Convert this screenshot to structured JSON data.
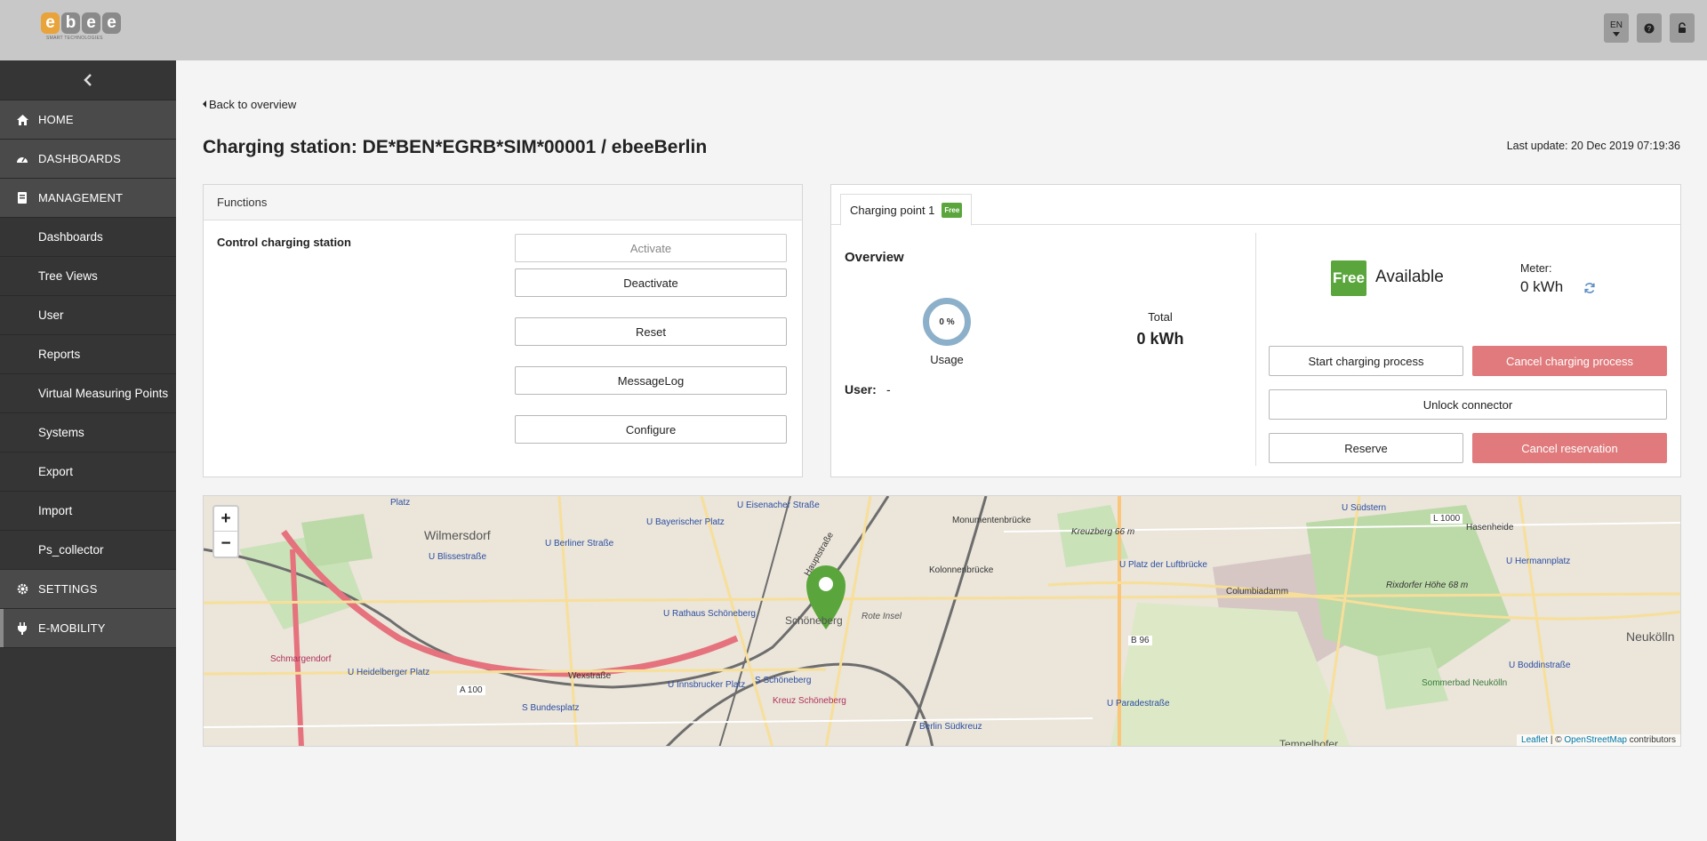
{
  "header": {
    "logo_text": [
      "e",
      "b",
      "e",
      "e"
    ],
    "logo_sub": "SMART TECHNOLOGIES",
    "lang_label": "EN",
    "help_icon": "question-icon",
    "lock_icon": "lock-icon"
  },
  "sidebar": {
    "collapse_icon": "chevron-left-icon",
    "items": [
      {
        "label": "HOME",
        "icon": "home-icon",
        "level": "top"
      },
      {
        "label": "DASHBOARDS",
        "icon": "dashboard-icon",
        "level": "top"
      },
      {
        "label": "MANAGEMENT",
        "icon": "book-icon",
        "level": "top"
      },
      {
        "label": "Dashboards",
        "level": "sub"
      },
      {
        "label": "Tree Views",
        "level": "sub"
      },
      {
        "label": "User",
        "level": "sub"
      },
      {
        "label": "Reports",
        "level": "sub"
      },
      {
        "label": "Virtual Measuring Points",
        "level": "sub"
      },
      {
        "label": "Systems",
        "level": "sub"
      },
      {
        "label": "Export",
        "level": "sub"
      },
      {
        "label": "Import",
        "level": "sub"
      },
      {
        "label": "Ps_collector",
        "level": "sub"
      },
      {
        "label": "SETTINGS",
        "icon": "gear-icon",
        "level": "top"
      },
      {
        "label": "E-MOBILITY",
        "icon": "plug-icon",
        "level": "top"
      }
    ]
  },
  "main": {
    "back_label": "Back to overview",
    "title": "Charging station: DE*BEN*EGRB*SIM*00001 / ebeeBerlin",
    "last_update": "Last update: 20 Dec 2019 07:19:36"
  },
  "functions": {
    "heading": "Functions",
    "control_label": "Control charging station",
    "buttons": {
      "activate": "Activate",
      "deactivate": "Deactivate",
      "reset": "Reset",
      "messagelog": "MessageLog",
      "configure": "Configure"
    }
  },
  "charging_point": {
    "tab_label": "Charging point 1",
    "tab_badge": "Free",
    "overview_title": "Overview",
    "usage_percent": "0 %",
    "usage_label": "Usage",
    "total_label": "Total",
    "total_value": "0 kWh",
    "user_label": "User:",
    "user_value": "-",
    "status_badge": "Free",
    "status_text": "Available",
    "meter_label": "Meter:",
    "meter_value": "0 kWh",
    "buttons": {
      "start": "Start charging process",
      "cancel_charging": "Cancel charging process",
      "unlock": "Unlock connector",
      "reserve": "Reserve",
      "cancel_reservation": "Cancel reservation"
    }
  },
  "map": {
    "zoom_in": "+",
    "zoom_out": "−",
    "attribution_leaflet": "Leaflet",
    "attribution_sep": " | © ",
    "attribution_osm": "OpenStreetMap",
    "attribution_tail": " contributors",
    "labels": {
      "wilmersdorf": "Wilmersdorf",
      "schoeneberg": "Schöneberg",
      "neukolln": "Neukölln",
      "u_eisenacher": "U Eisenacher Straße",
      "u_bayerischer": "U Bayerischer Platz",
      "u_berliner": "U Berliner Straße",
      "u_blissestr": "U Blissestraße",
      "u_rathaus": "U Rathaus Schöneberg",
      "u_innsbrucker": "U Innsbrucker Platz",
      "s_schoeneberg": "S Schöneberg",
      "s_bundesplatz": "S Bundesplatz",
      "u_heidelberger": "U Heidelberger Platz",
      "schmargendorf": "Schmargendorf",
      "monumentenbr": "Monumentenbrücke",
      "kolonnenbr": "Kolonnenbrücke",
      "u_platz_luft": "U Platz der Luftbrücke",
      "u_paradestr": "U Paradestraße",
      "u_suedstern": "U Südstern",
      "u_hermannplatz": "U Hermannplatz",
      "u_boddinstr": "U Boddinstraße",
      "columbiadamm": "Columbiadamm",
      "berlin_suedkreuz": "Berlin Südkreuz",
      "a100": "A 100",
      "b96": "B 96",
      "l1000": "L 1000",
      "kreuzberg": "Kreuzberg 66 m",
      "rixdorfer": "Rixdorfer Höhe 68 m",
      "sommerbad": "Sommerbad Neukölln",
      "kreuz_schoeneberg": "Kreuz Schöneberg",
      "wexstrasse": "Wexstraße",
      "hauptstrasse": "Hauptstraße",
      "rote_insel": "Rote Insel",
      "hasenheide": "Hasenheide",
      "platz": "Platz",
      "tempelhof": "Tempelhofer"
    }
  }
}
